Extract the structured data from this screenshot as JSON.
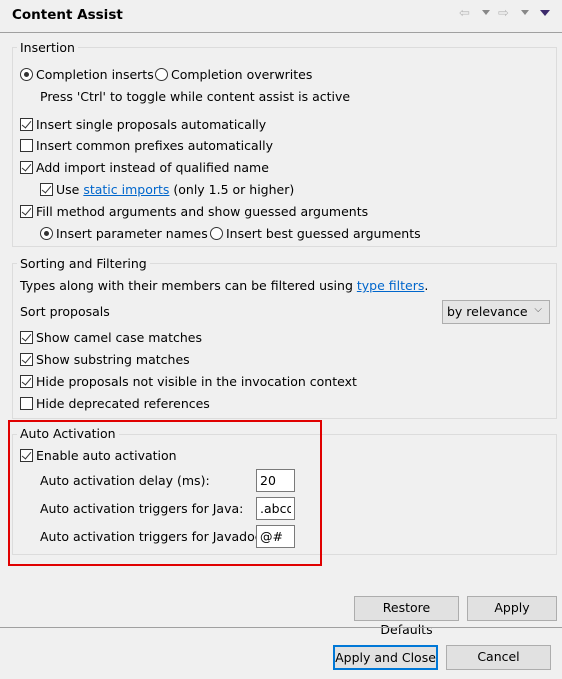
{
  "header": {
    "title": "Content Assist",
    "icons": [
      "back-arrow-icon",
      "dropdown-icon",
      "forward-arrow-icon",
      "dropdown-icon",
      "view-menu-icon"
    ]
  },
  "insertion": {
    "legend": "Insertion",
    "radio_inserts": "Completion inserts",
    "radio_overwrites": "Completion overwrites",
    "selected": "Completion inserts",
    "hint": "Press 'Ctrl' to toggle while content assist is active",
    "insert_single": {
      "label": "Insert single proposals automatically",
      "checked": true
    },
    "insert_common": {
      "label": "Insert common prefixes automatically",
      "checked": false
    },
    "add_import": {
      "label": "Add import instead of qualified name",
      "checked": true
    },
    "use_static": {
      "prefix": "Use ",
      "link": "static imports",
      "suffix": " (only 1.5 or higher)",
      "checked": true
    },
    "fill_args": {
      "label": "Fill method arguments and show guessed arguments",
      "checked": true
    },
    "radio_param_names": "Insert parameter names",
    "radio_best_guessed": "Insert best guessed arguments",
    "args_selected": "Insert parameter names"
  },
  "sorting": {
    "legend": "Sorting and Filtering",
    "desc_prefix": "Types along with their members can be filtered using ",
    "desc_link": "type filters",
    "desc_suffix": ".",
    "sort_label": "Sort proposals",
    "sort_value": "by relevance",
    "camel": {
      "label": "Show camel case matches",
      "checked": true
    },
    "substring": {
      "label": "Show substring matches",
      "checked": true
    },
    "hide_not_visible": {
      "label": "Hide proposals not visible in the invocation context",
      "checked": true
    },
    "hide_deprecated": {
      "label": "Hide deprecated references",
      "checked": false
    }
  },
  "auto": {
    "legend": "Auto Activation",
    "enable": {
      "label": "Enable auto activation",
      "checked": true
    },
    "delay_label": "Auto activation delay (ms):",
    "delay_value": "20",
    "java_label": "Auto activation triggers for Java:",
    "java_value": ".abcd",
    "javadoc_label": "Auto activation triggers for Javadoc:",
    "javadoc_value": "@#",
    "highlight_color": "#e00000"
  },
  "buttons": {
    "restore": "Restore Defaults",
    "apply": "Apply",
    "apply_close": "Apply and Close",
    "cancel": "Cancel"
  }
}
